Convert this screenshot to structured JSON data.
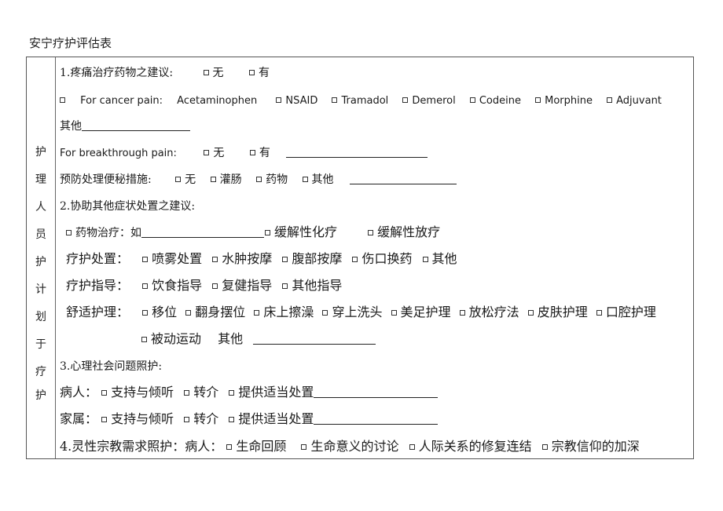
{
  "document": {
    "title": "安宁疗护评估表"
  },
  "side_label": [
    "护",
    "理",
    "人",
    "员",
    "护",
    "计",
    "划",
    "于",
    "疗",
    "护"
  ],
  "section1": {
    "heading": "1.疼痛治疗药物之建议:",
    "options": [
      "无",
      "有"
    ],
    "cancer_pain": {
      "label": "For cancer pain:",
      "first_option": "Acetaminophen",
      "options": [
        "NSAID",
        "Tramadol",
        "Demerol",
        "Codeine",
        "Morphine",
        "Adjuvant"
      ]
    },
    "other_label": "其他",
    "breakthrough": {
      "label": "For breakthrough pain:",
      "options": [
        "无",
        "有"
      ]
    },
    "constipation": {
      "label": "预防处理便秘措施:",
      "options": [
        "无",
        "灌肠",
        "药物",
        "其他"
      ]
    }
  },
  "section2": {
    "heading": "2.协助其他症状处置之建议:",
    "medication": {
      "label": "药物治疗：如",
      "options": [
        "缓解性化疗",
        "缓解性放疗"
      ]
    },
    "treatment": {
      "label": "疗护处置：",
      "options": [
        "喷雾处置",
        "水肿按摩",
        "腹部按摩",
        "伤口换药",
        "其他"
      ]
    },
    "guidance": {
      "label": "疗护指导：",
      "options": [
        "饮食指导",
        "复健指导",
        "其他指导"
      ]
    },
    "comfort": {
      "label": "舒适护理：",
      "options": [
        "移位",
        "翻身摆位",
        "床上擦澡",
        "穿上洗头",
        "美足护理",
        "放松疗法",
        "皮肤护理",
        "口腔护理"
      ],
      "options_line2": [
        "被动运动"
      ],
      "other_label": "其他"
    }
  },
  "section3": {
    "heading": "3.心理社会问题照护:",
    "patient": {
      "label": "病人：",
      "options": [
        "支持与倾听",
        "转介",
        "提供适当处置"
      ]
    },
    "family": {
      "label": "家属：",
      "options": [
        "支持与倾听",
        "转介",
        "提供适当处置"
      ]
    }
  },
  "section4": {
    "heading": "4.灵性宗教需求照护：病人：",
    "options": [
      "生命回顾",
      "生命意义的讨论",
      "人际关系的修复连结",
      "宗教信仰的加深"
    ]
  }
}
